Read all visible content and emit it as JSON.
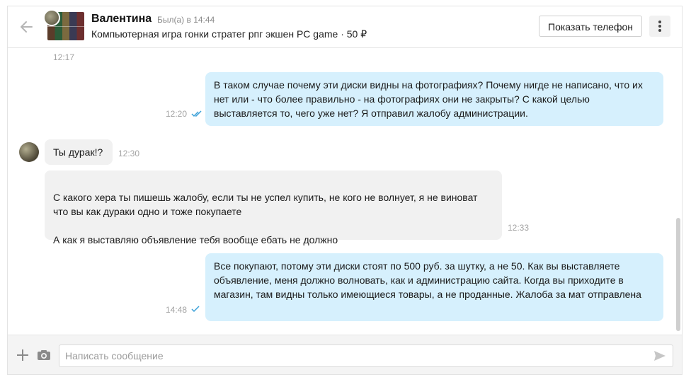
{
  "header": {
    "user_name": "Валентина",
    "last_seen": "Был(а) в 14:44",
    "item_title": "Компьютерная игра гонки стратег рпг экшен PC game · 50 ₽",
    "show_phone_label": "Показать телефон"
  },
  "messages": [
    {
      "type": "time-only",
      "time": "12:17"
    },
    {
      "type": "outgoing",
      "text": "В таком случае почему эти диски видны на фотографиях? Почему нигде не написано, что их нет или - что более правильно - на фотографиях они не закрыты? С какой целью выставляется то, чего уже нет? Я отправил жалобу администрации.",
      "time": "12:20",
      "status": "read"
    },
    {
      "type": "incoming",
      "text": "Ты дурак!?",
      "time": "12:30"
    },
    {
      "type": "incoming",
      "text": "С какого хера ты пишешь жалобу, если ты не успел купить, не кого не волнует, я не виноват что вы как дураки одно и тоже покупаете\n\nА как я выставляю объявление тебя вообще ебать не должно",
      "time": "12:33"
    },
    {
      "type": "outgoing",
      "text": "Все покупают, потому эти диски стоят по 500 руб. за шутку, а не 50. Как вы выставляете объявление, меня должно волновать, как и администрацию сайта. Когда вы приходите в магазин, там видны только имеющиеся товары, а не проданные. Жалоба за мат отправлена",
      "time": "14:48",
      "status": "sent"
    }
  ],
  "composer": {
    "placeholder": "Написать сообщение"
  },
  "colors": {
    "outgoing_bubble": "#d6f0fd",
    "incoming_bubble": "#f1f1f1",
    "read_check": "#3aa0d8"
  }
}
